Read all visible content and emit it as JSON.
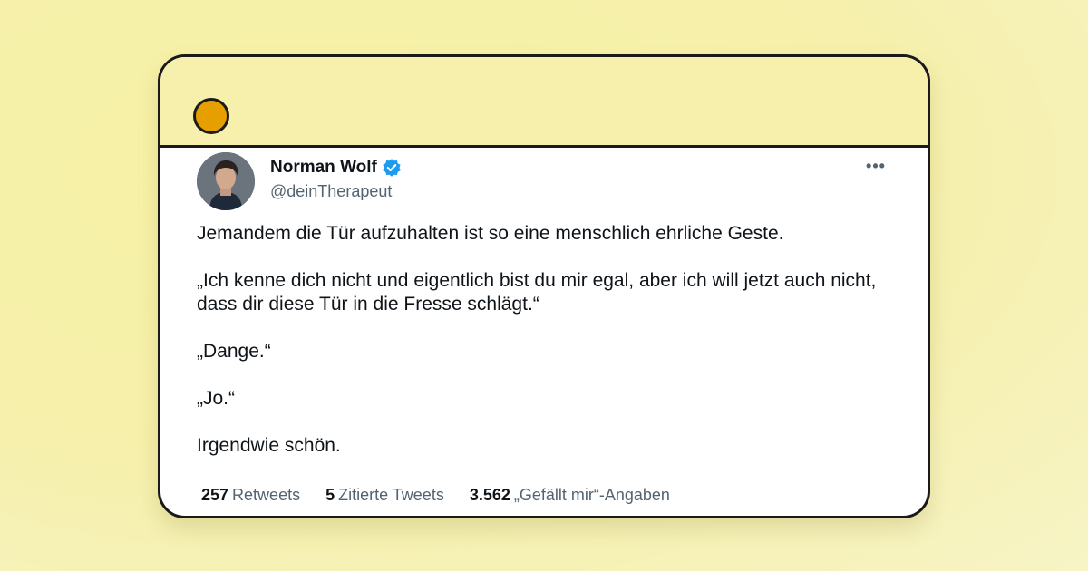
{
  "tweet": {
    "author": {
      "display_name": "Norman Wolf",
      "handle": "@deinTherapeut",
      "verified": true,
      "avatar_icon": "user-photo-avatar",
      "verified_icon": "verified-badge-icon",
      "verified_color": "#1d9bf0"
    },
    "more_label": "•••",
    "paragraphs": [
      "Jemandem die Tür aufzuhalten ist so eine menschlich ehrliche Geste.",
      "„Ich kenne dich nicht und eigentlich bist du mir egal, aber ich will jetzt auch nicht, dass dir diese Tür in die Fresse schlägt.“",
      "„Dange.“",
      "„Jo.“",
      "Irgendwie schön."
    ],
    "stats": [
      {
        "count": "257",
        "label": "Retweets"
      },
      {
        "count": "5",
        "label": "Zitierte Tweets"
      },
      {
        "count": "3.562",
        "label": "„Gefällt mir“-Angaben"
      }
    ]
  },
  "colors": {
    "background": "#f6f0ac",
    "window_dot": "#e5a000",
    "border": "#1a1a1a",
    "text_primary": "#0f1419",
    "text_secondary": "#536471"
  }
}
